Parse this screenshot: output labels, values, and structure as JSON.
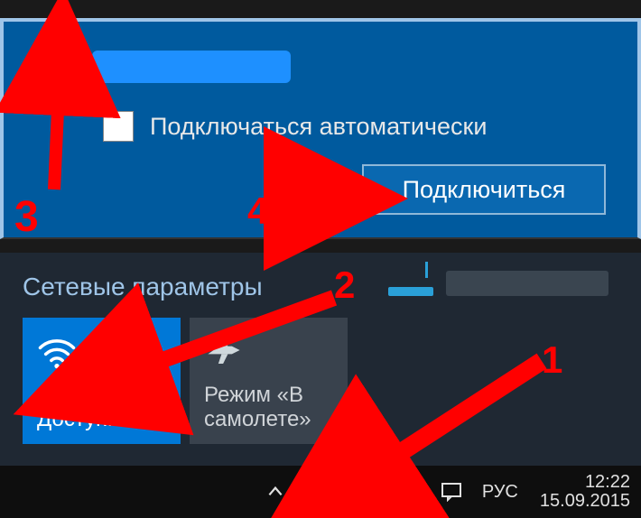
{
  "top": {
    "auto_connect_label": "Подключаться автоматически",
    "connect_label": "Подключиться"
  },
  "bottom": {
    "title": "Сетевые параметры",
    "wifi_tile_label": "Доступно",
    "airplane_tile_label": "Режим «В самолете»"
  },
  "taskbar": {
    "lang": "РУС",
    "time": "12:22",
    "date": "15.09.2015"
  },
  "markers": {
    "m1": "1",
    "m2": "2",
    "m3": "3",
    "m4": "4"
  }
}
